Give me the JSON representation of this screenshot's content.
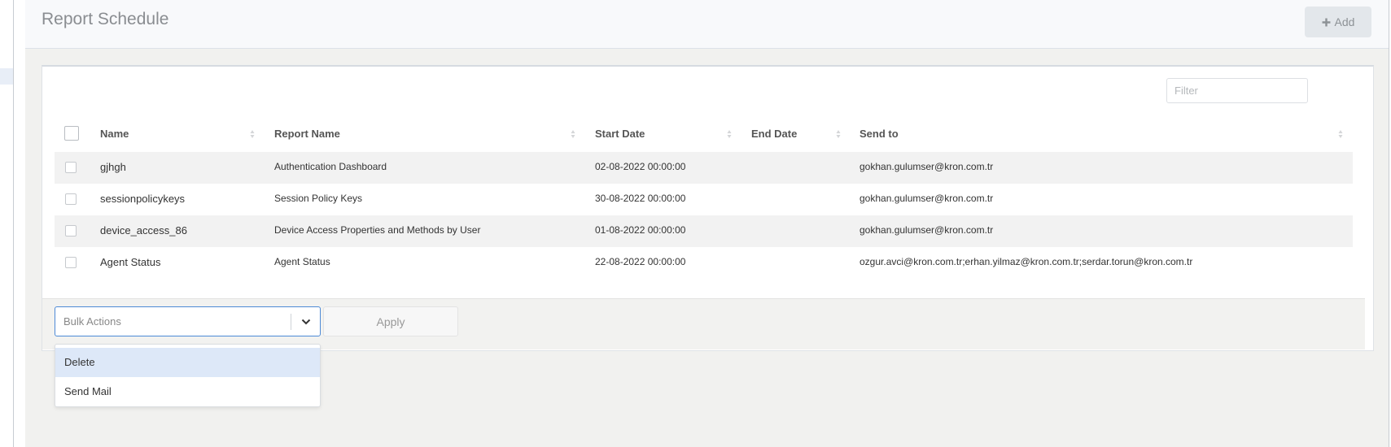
{
  "page": {
    "title": "Report Schedule"
  },
  "header": {
    "add_label": "Add"
  },
  "table": {
    "filter_placeholder": "Filter",
    "columns": [
      "Name",
      "Report Name",
      "Start Date",
      "End Date",
      "Send to"
    ],
    "rows": [
      {
        "name": "gjhgh",
        "report_name": "Authentication Dashboard",
        "start_date": "02-08-2022 00:00:00",
        "end_date": "",
        "send_to": "gokhan.gulumser@kron.com.tr"
      },
      {
        "name": "sessionpolicykeys",
        "report_name": "Session Policy Keys",
        "start_date": "30-08-2022 00:00:00",
        "end_date": "",
        "send_to": "gokhan.gulumser@kron.com.tr"
      },
      {
        "name": "device_access_86",
        "report_name": "Device Access Properties and Methods by User",
        "start_date": "01-08-2022 00:00:00",
        "end_date": "",
        "send_to": "gokhan.gulumser@kron.com.tr"
      },
      {
        "name": "Agent Status",
        "report_name": "Agent Status",
        "start_date": "22-08-2022 00:00:00",
        "end_date": "",
        "send_to": "ozgur.avci@kron.com.tr;erhan.yilmaz@kron.com.tr;serdar.torun@kron.com.tr"
      }
    ]
  },
  "bulk": {
    "placeholder": "Bulk Actions",
    "apply_label": "Apply",
    "options": [
      "Delete",
      "Send Mail"
    ],
    "highlighted_option": "Delete"
  },
  "icons": {
    "add": "plus-icon",
    "dropdown": "chevron-down-icon",
    "sort": "sort-icon"
  },
  "colors": {
    "select_focus": "#4d8ad6",
    "option_highlight": "#dde8f8"
  }
}
